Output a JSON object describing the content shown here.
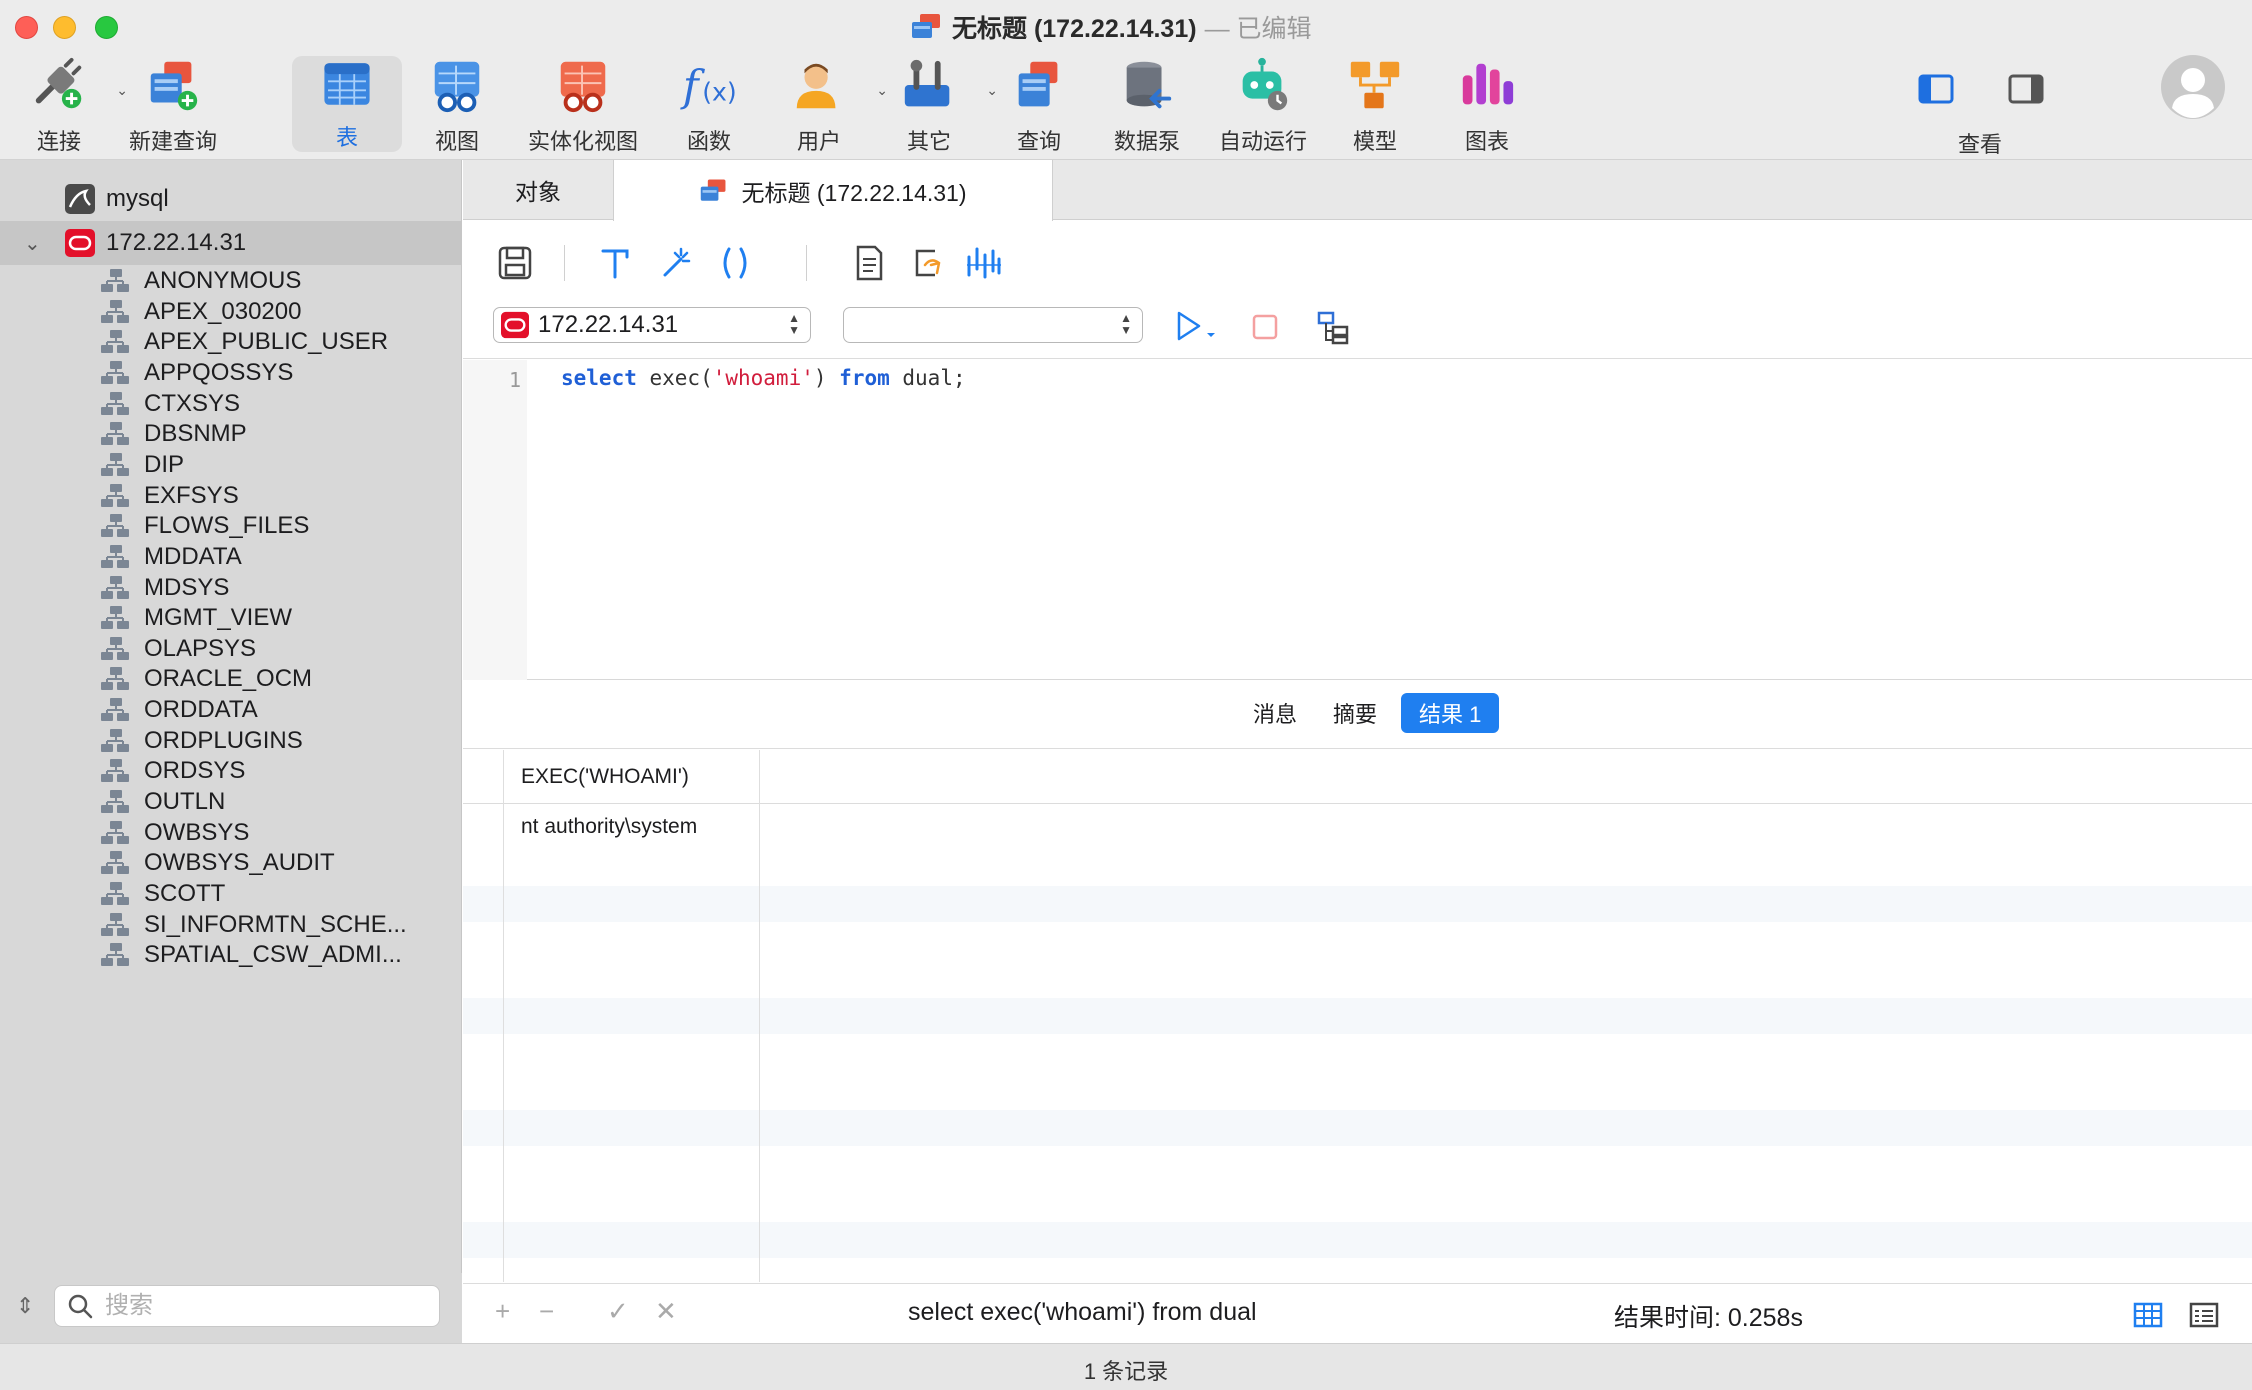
{
  "window": {
    "title": "无标题 (172.22.14.31)",
    "edited": "— 已编辑"
  },
  "toolbar": {
    "connect": "连接",
    "new_query": "新建查询",
    "table": "表",
    "view": "视图",
    "materialized_view": "实体化视图",
    "function": "函数",
    "user": "用户",
    "other": "其它",
    "query": "查询",
    "data_pump": "数据泵",
    "automation": "自动运行",
    "model": "模型",
    "chart": "图表",
    "view_menu": "查看"
  },
  "sidebar": {
    "connections": [
      {
        "label": "mysql"
      },
      {
        "label": "172.22.14.31"
      }
    ],
    "schemas": [
      "ANONYMOUS",
      "APEX_030200",
      "APEX_PUBLIC_USER",
      "APPQOSSYS",
      "CTXSYS",
      "DBSNMP",
      "DIP",
      "EXFSYS",
      "FLOWS_FILES",
      "MDDATA",
      "MDSYS",
      "MGMT_VIEW",
      "OLAPSYS",
      "ORACLE_OCM",
      "ORDDATA",
      "ORDPLUGINS",
      "ORDSYS",
      "OUTLN",
      "OWBSYS",
      "OWBSYS_AUDIT",
      "SCOTT",
      "SI_INFORMTN_SCHE...",
      "SPATIAL_CSW_ADMI..."
    ],
    "search_placeholder": "搜索"
  },
  "tabs": {
    "objects": "对象",
    "query_tab": "无标题 (172.22.14.31)"
  },
  "editor": {
    "connection_select": "172.22.14.31",
    "schema_select": "",
    "line_number": "1",
    "code": {
      "kw1": "select",
      "fn": " exec(",
      "str": "'whoami'",
      "mid": ") ",
      "kw2": "from",
      "tail": " dual;"
    }
  },
  "results": {
    "tabs": [
      "消息",
      "摘要",
      "结果 1"
    ],
    "column": "EXEC('WHOAMI')",
    "value": "nt authority\\system"
  },
  "bottom": {
    "sql": "select exec('whoami') from dual",
    "time": "结果时间: 0.258s"
  },
  "status": {
    "records": "1 条记录"
  },
  "colors": {
    "accent": "#1f7ff0",
    "oracle_red": "#e3102a",
    "keyword": "#1f5fd6",
    "string": "#d11d3c"
  }
}
